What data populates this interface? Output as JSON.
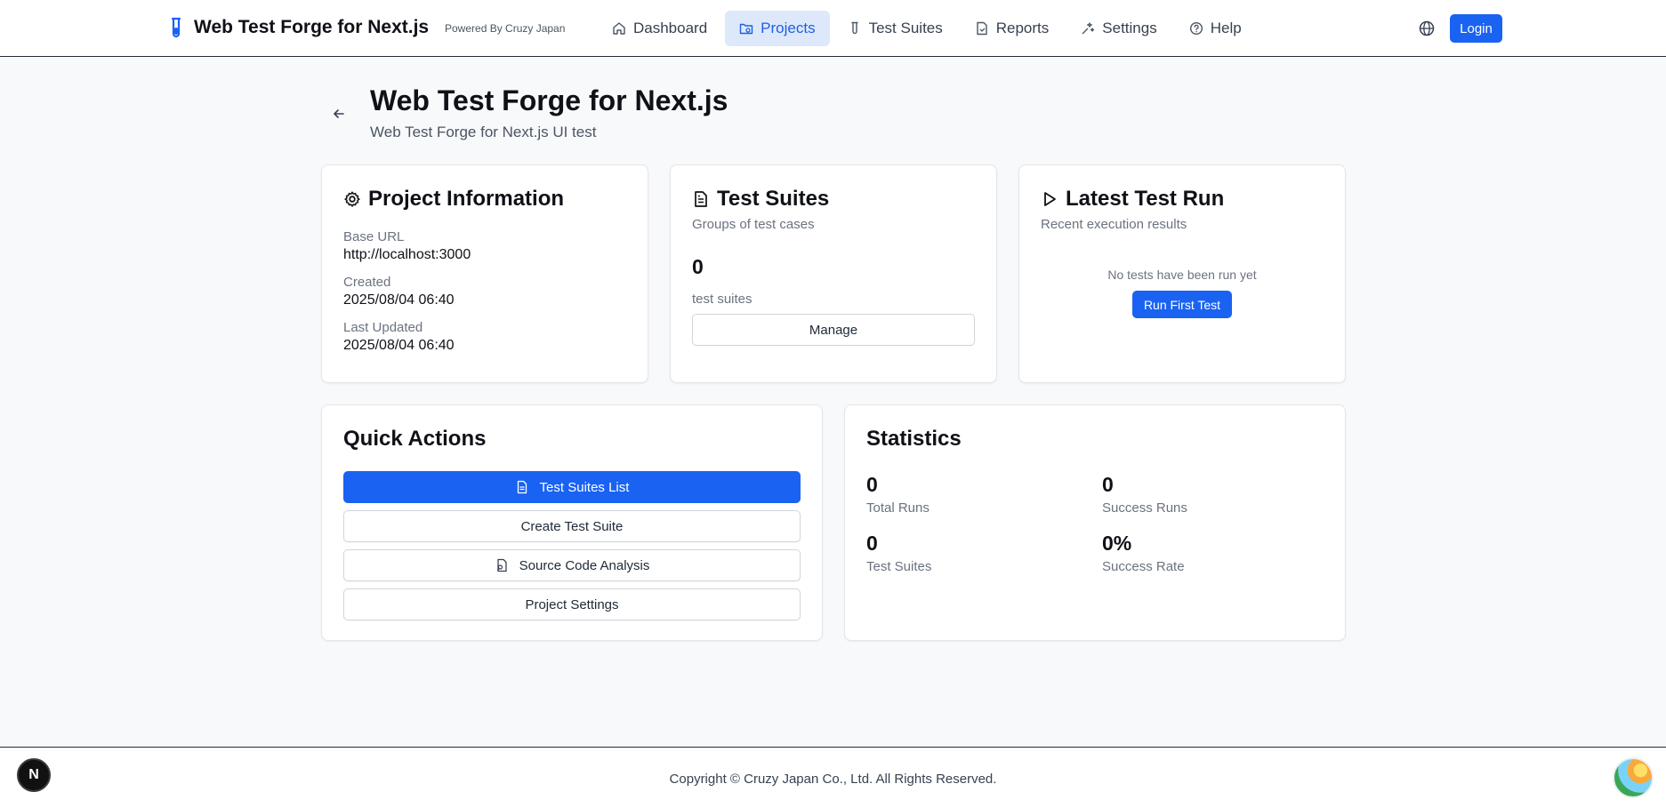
{
  "header": {
    "brand": "Web Test Forge for Next.js",
    "powered_by": "Powered By Cruzy Japan",
    "nav": [
      {
        "label": "Dashboard",
        "icon": "home-icon"
      },
      {
        "label": "Projects",
        "icon": "folder-icon"
      },
      {
        "label": "Test Suites",
        "icon": "test-tube-icon"
      },
      {
        "label": "Reports",
        "icon": "report-icon"
      },
      {
        "label": "Settings",
        "icon": "settings-icon"
      },
      {
        "label": "Help",
        "icon": "help-icon"
      }
    ],
    "active_nav": "Projects",
    "login_label": "Login"
  },
  "page": {
    "title": "Web Test Forge for Next.js",
    "subtitle": "Web Test Forge for Next.js UI test"
  },
  "project_info": {
    "title": "Project Information",
    "base_url_label": "Base URL",
    "base_url": "http://localhost:3000",
    "created_label": "Created",
    "created": "2025/08/04 06:40",
    "updated_label": "Last Updated",
    "updated": "2025/08/04 06:40"
  },
  "test_suites": {
    "title": "Test Suites",
    "description": "Groups of test cases",
    "count": "0",
    "count_label": "test suites",
    "manage_label": "Manage"
  },
  "latest_run": {
    "title": "Latest Test Run",
    "description": "Recent execution results",
    "empty_text": "No tests have been run yet",
    "run_label": "Run First Test"
  },
  "quick_actions": {
    "title": "Quick Actions",
    "list_label": "Test Suites List",
    "create_label": "Create Test Suite",
    "analysis_label": "Source Code Analysis",
    "settings_label": "Project Settings"
  },
  "statistics": {
    "title": "Statistics",
    "total_runs": "0",
    "total_runs_label": "Total Runs",
    "success_runs": "0",
    "success_runs_label": "Success Runs",
    "test_suites": "0",
    "test_suites_label": "Test Suites",
    "success_rate": "0%",
    "success_rate_label": "Success Rate"
  },
  "footer": {
    "copyright": "Copyright © Cruzy Japan Co., Ltd. All Rights Reserved.",
    "next_badge": "N"
  },
  "colors": {
    "primary": "#1a62f2",
    "active_nav_bg": "#dde9fb"
  }
}
